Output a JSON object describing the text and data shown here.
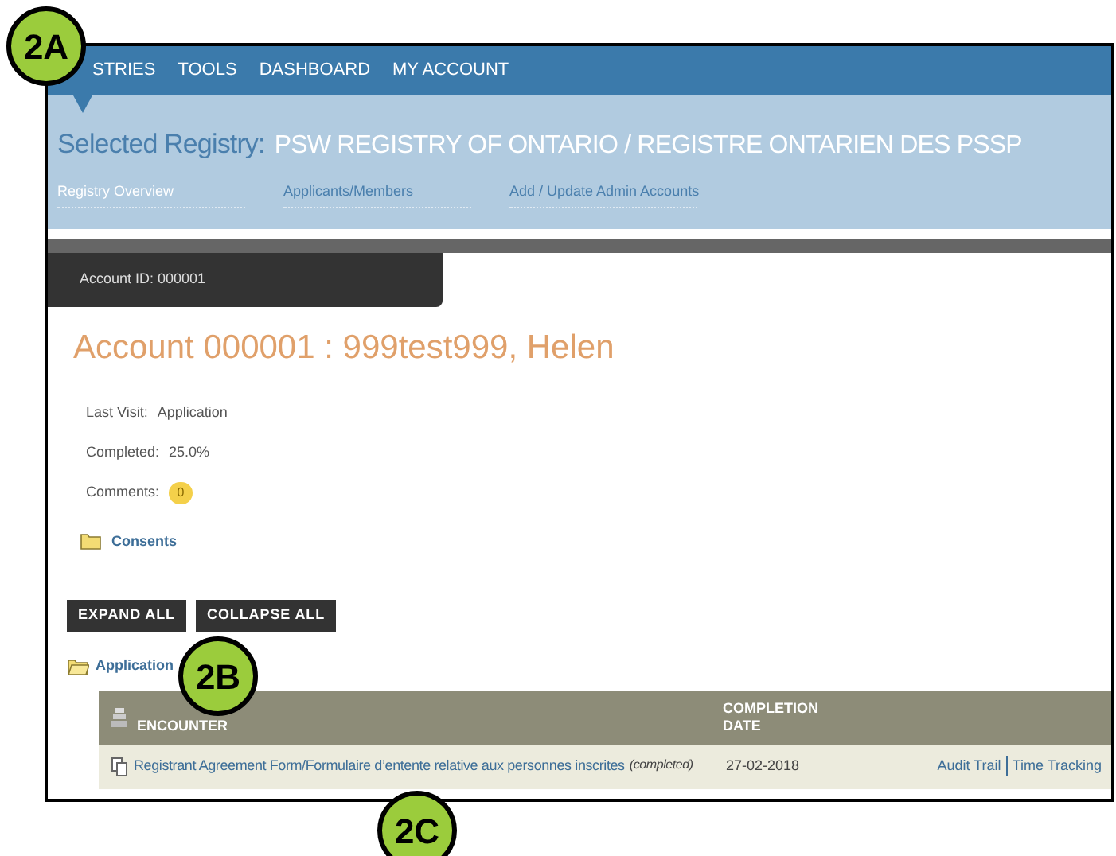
{
  "callouts": [
    {
      "label": "2A"
    },
    {
      "label": "2B"
    },
    {
      "label": "2C"
    }
  ],
  "nav": [
    "STRIES",
    "TOOLS",
    "DASHBOARD",
    "MY ACCOUNT"
  ],
  "registry": {
    "label": "Selected Registry:",
    "value": "PSW REGISTRY OF ONTARIO / REGISTRE ONTARIEN DES PSSP"
  },
  "tabs": [
    {
      "label": "Registry Overview",
      "selected": true
    },
    {
      "label": "Applicants/Members",
      "selected": false
    },
    {
      "label": "Add / Update Admin Accounts",
      "selected": false
    }
  ],
  "account_tab": "Account ID: 000001",
  "heading": "Account 000001 : 999test999, Helen",
  "fields": [
    {
      "label": "Last Visit:",
      "value": "Application",
      "kind": "text"
    },
    {
      "label": "Completed:",
      "value": "25.0%",
      "kind": "text"
    },
    {
      "label": "Comments:",
      "value": "0",
      "kind": "bubble"
    }
  ],
  "consents": "Consents",
  "buttons": [
    "EXPAND ALL",
    "COLLAPSE ALL"
  ],
  "application": "Application",
  "table": {
    "columns": [
      "ENCOUNTER",
      "COMPLETION DATE"
    ],
    "rows": [
      {
        "form": "Registrant Agreement Form/Formulaire d’entente relative aux personnes inscrites",
        "status": "(completed)",
        "date": "27-02-2018",
        "links": [
          "Audit Trail",
          "Time Tracking"
        ]
      }
    ]
  }
}
